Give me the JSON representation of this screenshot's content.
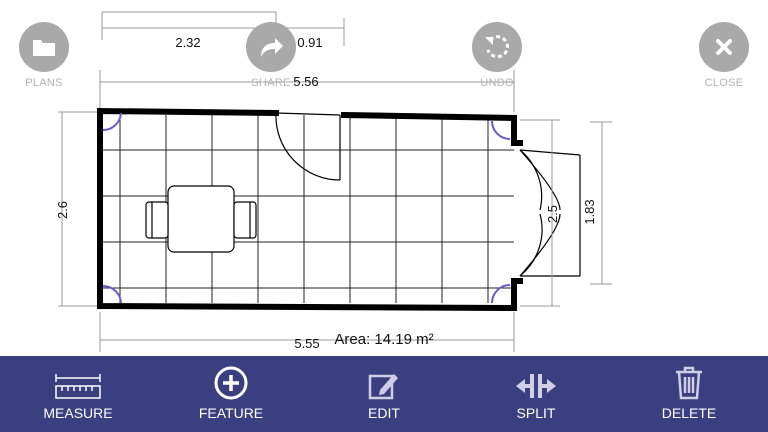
{
  "top_buttons": {
    "plans": {
      "label": "PLANS",
      "icon": "folder-icon"
    },
    "share": {
      "label": "SHARE",
      "icon": "share-arrow-icon"
    },
    "undo": {
      "label": "UNDO",
      "icon": "undo-icon"
    },
    "close": {
      "label": "CLOSE",
      "icon": "close-icon"
    }
  },
  "plan": {
    "dimensions": {
      "top_left": "2.32",
      "top_right": "0.91",
      "total_width": "5.56",
      "left_height": "2.6",
      "door_height": "2.5",
      "door_opening": "1.83",
      "bottom_width": "5.55"
    },
    "area": "Area: 14.19 m²"
  },
  "toolbar": {
    "measure": {
      "label": "MEASURE",
      "icon": "ruler-icon"
    },
    "feature": {
      "label": "FEATURE",
      "icon": "add-circle-icon"
    },
    "edit": {
      "label": "EDIT",
      "icon": "edit-icon"
    },
    "split": {
      "label": "SPLIT",
      "icon": "split-icon"
    },
    "delete": {
      "label": "DELETE",
      "icon": "trash-icon"
    }
  },
  "colors": {
    "toolbar_bg": "#3a3f7f",
    "button_gray": "#a9a9a9",
    "corner_arc": "#6a5acd"
  }
}
